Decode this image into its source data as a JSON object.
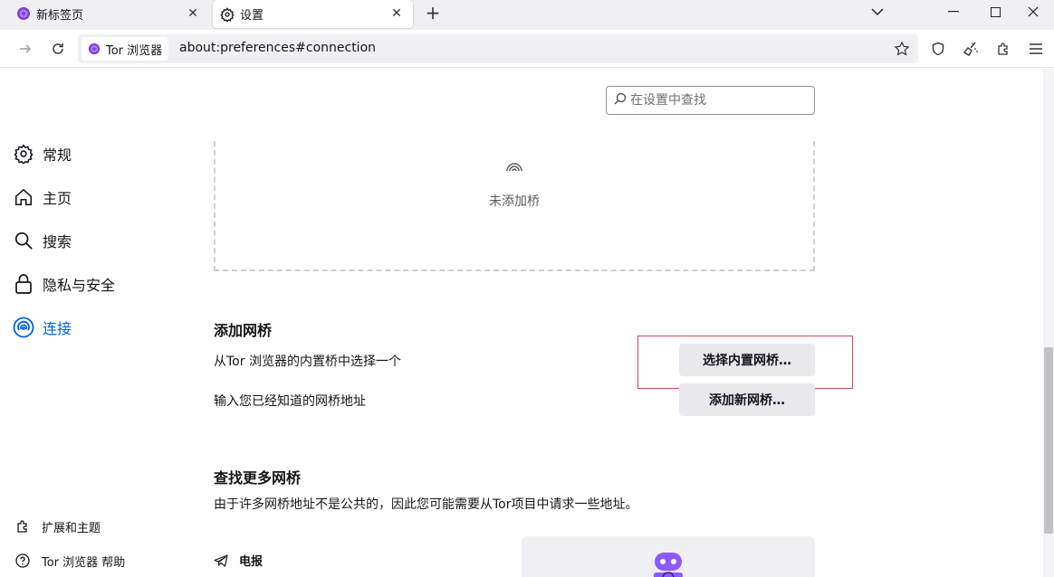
{
  "tabs": [
    {
      "label": "新标签页",
      "active": false
    },
    {
      "label": "设置",
      "active": true
    }
  ],
  "toolbar": {
    "identity_label": "Tor 浏览器",
    "url": "about:preferences#connection"
  },
  "search": {
    "placeholder": "在设置中查找"
  },
  "sidebar": {
    "items": [
      {
        "label": "常规",
        "icon": "gear-icon"
      },
      {
        "label": "主页",
        "icon": "home-icon"
      },
      {
        "label": "搜索",
        "icon": "search-icon"
      },
      {
        "label": "隐私与安全",
        "icon": "lock-icon"
      },
      {
        "label": "连接",
        "icon": "connection-icon",
        "active": true
      }
    ],
    "footer": [
      {
        "label": "扩展和主题",
        "icon": "puzzle-icon"
      },
      {
        "label": "Tor 浏览器 帮助",
        "icon": "help-icon"
      }
    ]
  },
  "bridges": {
    "empty_text": "未添加桥"
  },
  "add_bridge": {
    "heading": "添加网桥",
    "builtin_text": "从Tor 浏览器的内置桥中选择一个",
    "builtin_button": "选择内置网桥…",
    "manual_text": "输入您已经知道的网桥地址",
    "manual_button": "添加新网桥…"
  },
  "find_more": {
    "heading": "查找更多网桥",
    "description": "由于许多网桥地址不是公共的，因此您可能需要从Tor项目中请求一些地址。",
    "telegram_label": "电报"
  },
  "colors": {
    "accent": "#0061e0",
    "tor_purple": "#7f3fd8",
    "highlight": "#d9474a"
  }
}
